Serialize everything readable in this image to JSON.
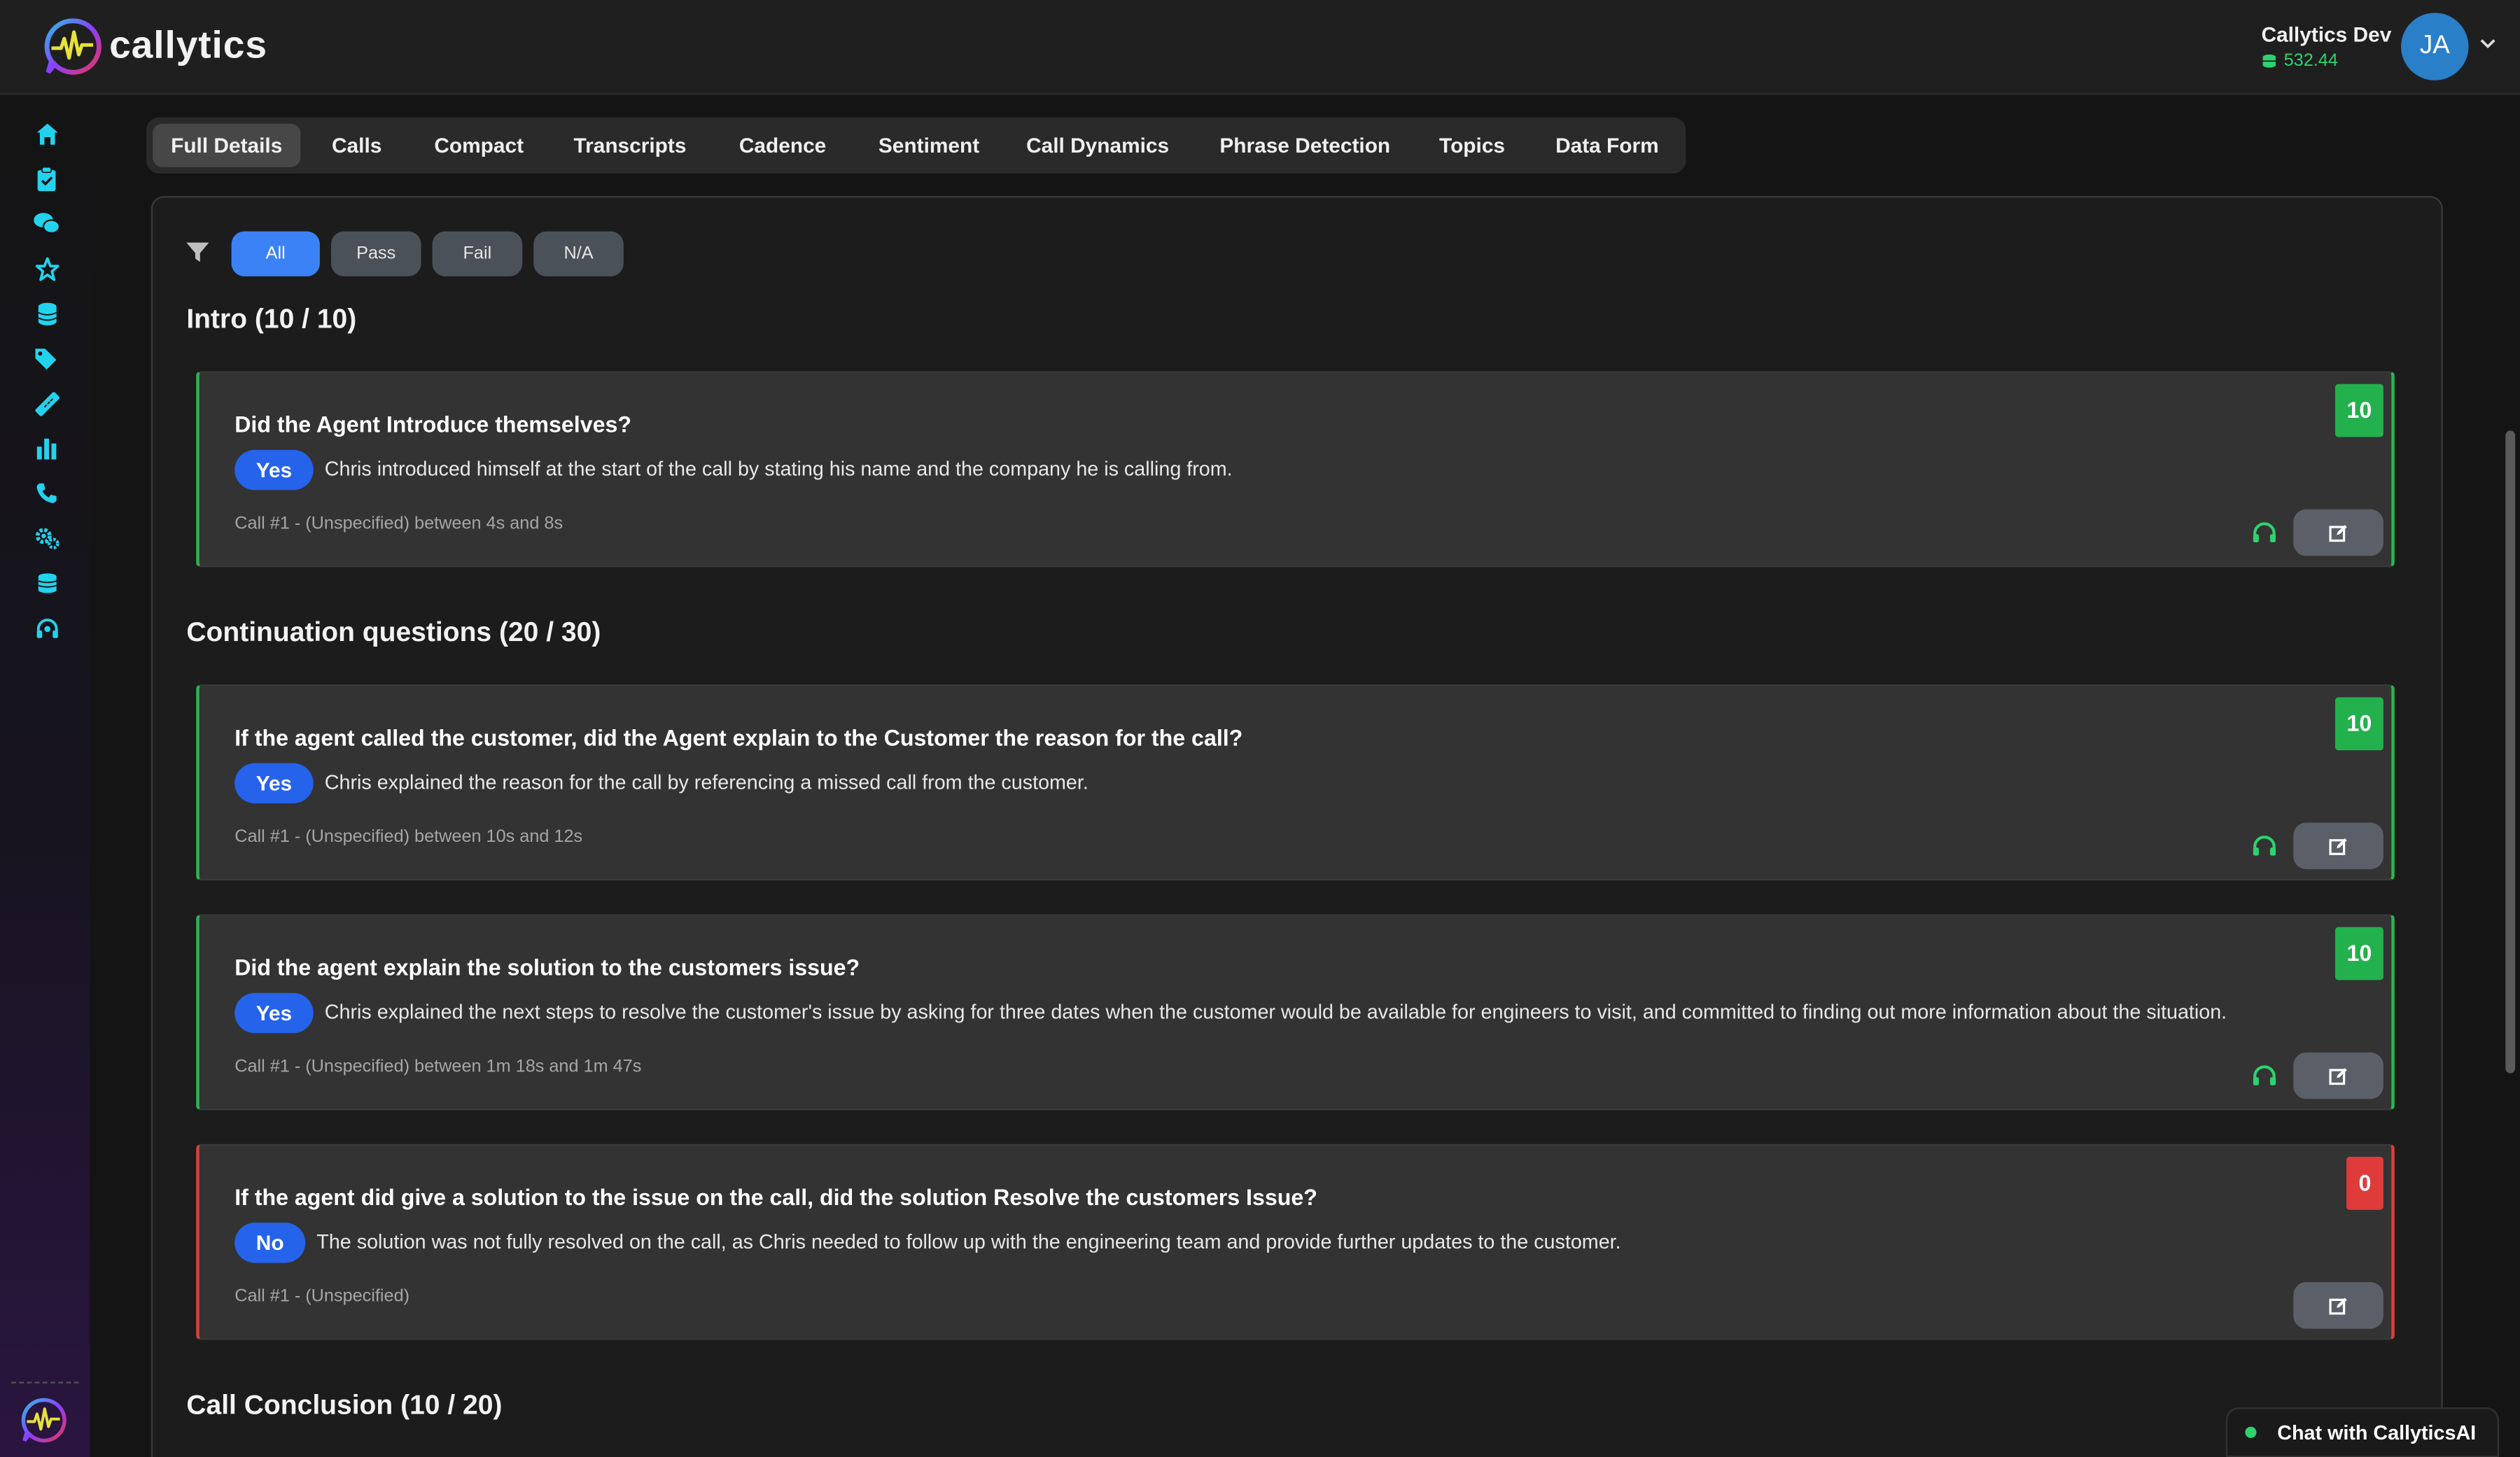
{
  "app": {
    "name": "callytics",
    "brand_color": "#2dd36f",
    "accent_color": "#3b82f6"
  },
  "account": {
    "name": "Callytics Dev",
    "balance": "532.44",
    "initials": "JA"
  },
  "sidebar": {
    "items": [
      {
        "icon": "home-icon"
      },
      {
        "icon": "clipboard-check-icon"
      },
      {
        "icon": "chat-bubbles-icon"
      },
      {
        "icon": "star-icon"
      },
      {
        "icon": "database-icon"
      },
      {
        "icon": "tags-icon"
      },
      {
        "icon": "ruler-icon"
      },
      {
        "icon": "bar-chart-icon"
      },
      {
        "icon": "phone-icon"
      },
      {
        "icon": "settings-gears-icon"
      },
      {
        "icon": "coins-icon"
      },
      {
        "icon": "headset-icon"
      }
    ]
  },
  "tabs": [
    "Full Details",
    "Calls",
    "Compact",
    "Transcripts",
    "Cadence",
    "Sentiment",
    "Call Dynamics",
    "Phrase Detection",
    "Topics",
    "Data Form"
  ],
  "active_tab": "Full Details",
  "filters": [
    "All",
    "Pass",
    "Fail",
    "N/A"
  ],
  "active_filter": "All",
  "sections": [
    {
      "title": "Intro (10 / 10)",
      "questions": [
        {
          "question": "Did the Agent Introduce themselves?",
          "answer": "Yes",
          "explanation": "Chris introduced himself at the start of the call by stating his name and the company he is calling from.",
          "meta": "Call #1 - (Unspecified) between 4s and 8s",
          "score": "10",
          "status": "pass"
        }
      ]
    },
    {
      "title": "Continuation questions (20 / 30)",
      "questions": [
        {
          "question": "If the agent called the customer, did the Agent explain to the Customer the reason for the call?",
          "answer": "Yes",
          "explanation": "Chris explained the reason for the call by referencing a missed call from the customer.",
          "meta": "Call #1 - (Unspecified) between 10s and 12s",
          "score": "10",
          "status": "pass"
        },
        {
          "question": "Did the agent explain the solution to the customers issue?",
          "answer": "Yes",
          "explanation": "Chris explained the next steps to resolve the customer's issue by asking for three dates when the customer would be available for engineers to visit, and committed to finding out more information about the situation.",
          "meta": "Call #1 - (Unspecified) between 1m 18s and 1m 47s",
          "score": "10",
          "status": "pass"
        },
        {
          "question": "If the agent did give a solution to the issue on the call, did the solution Resolve the customers Issue?",
          "answer": "No",
          "explanation": "The solution was not fully resolved on the call, as Chris needed to follow up with the engineering team and provide further updates to the customer.",
          "meta": "Call #1 - (Unspecified)",
          "score": "0",
          "status": "fail"
        }
      ]
    },
    {
      "title": "Call Conclusion (10 / 20)",
      "questions": []
    }
  ],
  "chat": {
    "label": "Chat with CallyticsAI"
  }
}
